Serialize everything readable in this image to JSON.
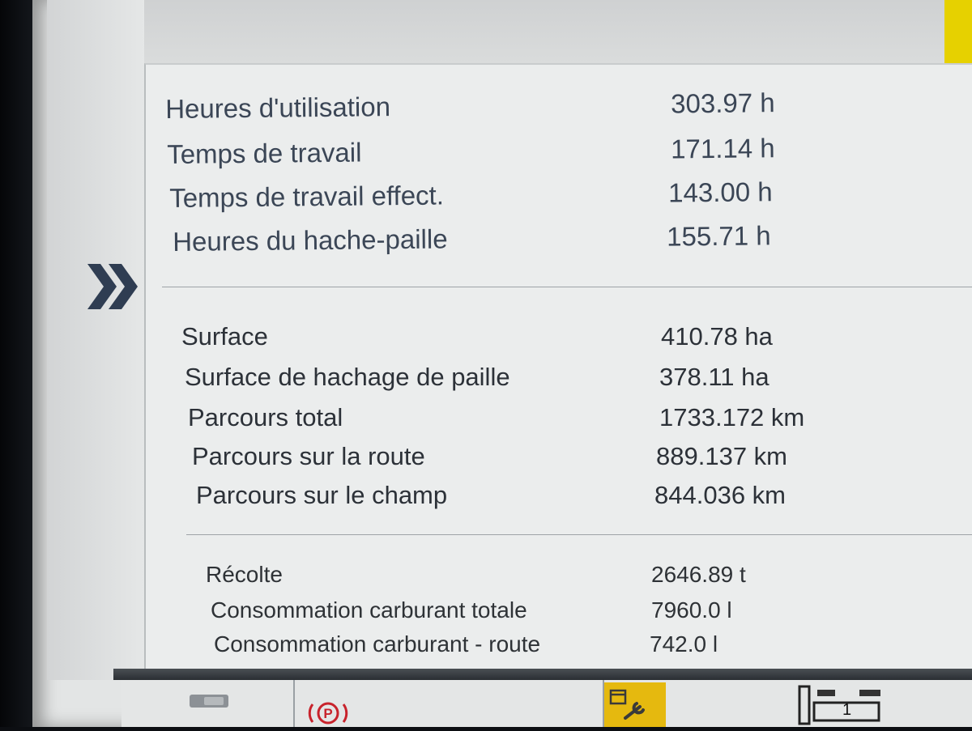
{
  "section_hours": [
    {
      "label": "Heures d'utilisation",
      "value": "303.97 h"
    },
    {
      "label": "Temps de travail",
      "value": "171.14 h"
    },
    {
      "label": "Temps de travail effect.",
      "value": "143.00 h"
    },
    {
      "label": "Heures du hache-paille",
      "value": "155.71 h"
    }
  ],
  "section_distance": [
    {
      "label": "Surface",
      "value": "410.78 ha"
    },
    {
      "label": "Surface de hachage de paille",
      "value": "378.11 ha"
    },
    {
      "label": "Parcours total",
      "value": "1733.172 km"
    },
    {
      "label": "Parcours sur la route",
      "value": "889.137 km"
    },
    {
      "label": "Parcours sur le champ",
      "value": "844.036 km"
    }
  ],
  "section_harvest": [
    {
      "label": "Récolte",
      "value": "2646.89 t"
    },
    {
      "label": "Consommation carburant totale",
      "value": "7960.0 l"
    },
    {
      "label": "Consommation carburant - route",
      "value": "742.0 l"
    }
  ],
  "bottom_bar": {
    "camera_icon": "camera-icon",
    "parking_icon": "parking-brake-icon",
    "parking_letter": "P",
    "service_icon": "calendar-wrench-icon",
    "gear_icon": "gear-selector-icon",
    "gear_number": "1"
  },
  "nav_icon": "double-chevron-right-icon",
  "colors": {
    "accent_yellow": "#e6d100",
    "service_tab": "#e5b90f",
    "chevron": "#2f3d52",
    "parking_red": "#c8232c"
  }
}
